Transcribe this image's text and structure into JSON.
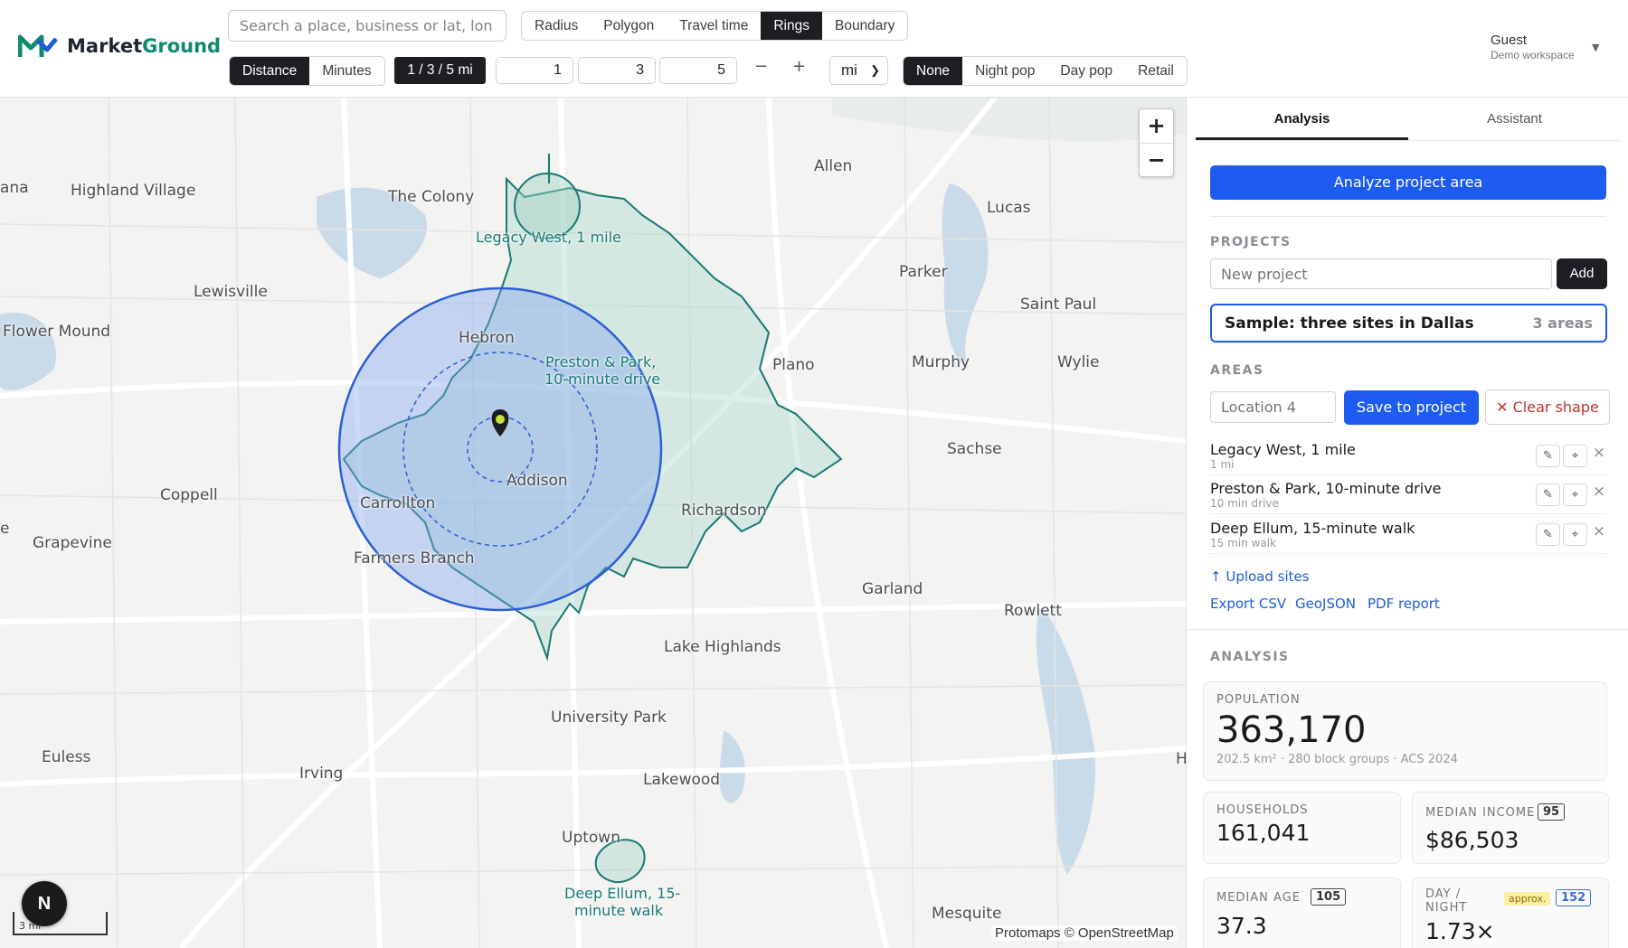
{
  "app": {
    "name_part1": "Market",
    "name_part2": "Ground"
  },
  "search": {
    "placeholder": "Search a place, business or lat, lon"
  },
  "modes": [
    "Radius",
    "Polygon",
    "Travel time",
    "Rings",
    "Boundary"
  ],
  "active_mode": "Rings",
  "ring_type": [
    "Distance",
    "Minutes"
  ],
  "ring_preset": "1 / 3 / 5 mi",
  "ring_values": [
    "1",
    "3",
    "5"
  ],
  "stepper": {
    "minus": "−",
    "plus": "+"
  },
  "unit": "mi",
  "overlays": [
    "None",
    "Night pop",
    "Day pop",
    "Retail"
  ],
  "user": {
    "name": "Guest",
    "workspace": "Demo workspace"
  },
  "map": {
    "places": [
      "ana",
      "Highland Village",
      "The Colony",
      "Allen",
      "Lucas",
      "Lewisville",
      "Parker",
      "Saint Paul",
      "Flower Mound",
      "Hebron",
      "Murphy",
      "Wylie",
      "Plano",
      "Sachse",
      "Addison",
      "Carrollton",
      "Richardson",
      "Coppell",
      "Grapevine",
      "e",
      "Farmers Branch",
      "Garland",
      "Rowlett",
      "Lake Highlands",
      "University Park",
      "Euless",
      "Irving",
      "Lakewood",
      "Uptown",
      "Mesquite",
      "H"
    ],
    "area_labels": [
      "Legacy West, 1 mile",
      "Preston & Park,",
      "10-minute drive",
      "Deep Ellum, 15-",
      "minute walk"
    ],
    "zoom_in": "+",
    "zoom_out": "−",
    "attribution": "Protomaps © OpenStreetMap",
    "scale_label": "3 mi",
    "compass": "N"
  },
  "panel": {
    "tabs": [
      "Analysis",
      "Assistant"
    ],
    "analyze_button": "Analyze project area",
    "projects_title": "PROJECTS",
    "new_project_placeholder": "New project",
    "add_button": "Add",
    "project": {
      "name": "Sample: three sites in Dallas",
      "count": "3 areas"
    },
    "areas_title": "AREAS",
    "location_placeholder": "Location 4",
    "save_button": "Save to project",
    "clear_button": "✕ Clear shape",
    "areas": [
      {
        "name": "Legacy West, 1 mile",
        "sub": "1 mi"
      },
      {
        "name": "Preston & Park, 10-minute drive",
        "sub": "10 min drive"
      },
      {
        "name": "Deep Ellum, 15-minute walk",
        "sub": "15 min walk"
      }
    ],
    "upload": "↑ Upload sites",
    "exports": [
      "Export CSV",
      "GeoJSON",
      "PDF report"
    ],
    "analysis_title": "ANALYSIS",
    "population": {
      "label": "POPULATION",
      "value": "363,170",
      "meta": "202.5 km² · 280 block groups · ACS 2024"
    },
    "households": {
      "label": "HOUSEHOLDS",
      "value": "161,041"
    },
    "income": {
      "label": "MEDIAN INCOME",
      "badge": "95",
      "value": "$86,503"
    },
    "age": {
      "label": "MEDIAN AGE",
      "badge": "105",
      "value": "37.3"
    },
    "daynight": {
      "label1": "DAY /",
      "label2": "NIGHT",
      "approx": "approx.",
      "badge": "152",
      "value": "1.73×"
    }
  },
  "colors": {
    "accent": "#1e5cf0",
    "dark": "#1c1e21",
    "teal": "#177a74",
    "ring_fill": "#b4c8f5"
  }
}
